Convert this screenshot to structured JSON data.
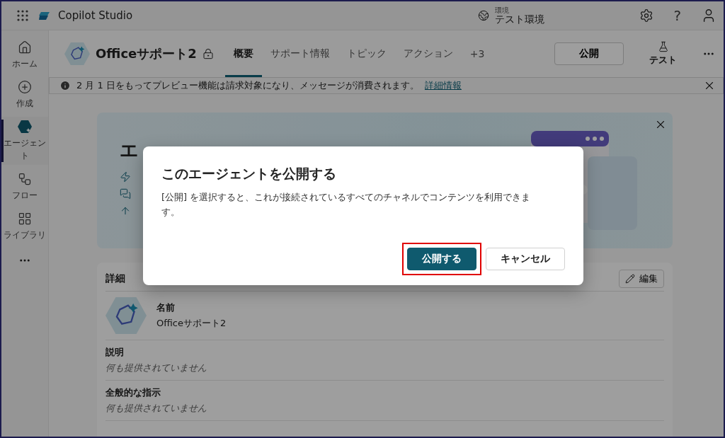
{
  "app": {
    "title": "Copilot Studio"
  },
  "environment": {
    "label": "環境",
    "name": "テスト環境"
  },
  "help": "?",
  "sidebar": {
    "items": [
      {
        "label": "ホーム",
        "selected": false
      },
      {
        "label": "作成",
        "selected": false
      },
      {
        "label": "エージェント",
        "selected": true
      },
      {
        "label": "フロー",
        "selected": false
      },
      {
        "label": "ライブラリ",
        "selected": false
      }
    ]
  },
  "agent": {
    "name": "Officeサポート2"
  },
  "tabs": [
    {
      "label": "概要",
      "selected": true
    },
    {
      "label": "サポート情報",
      "selected": false
    },
    {
      "label": "トピック",
      "selected": false
    },
    {
      "label": "アクション",
      "selected": false
    },
    {
      "label": "+3",
      "selected": false
    }
  ],
  "actions": {
    "publish": "公開",
    "test": "テスト"
  },
  "notice": {
    "text": "2 月 1 日をもってプレビュー機能は請求対象になり、メッセージが消費されます。",
    "link": "詳細情報"
  },
  "banner": {
    "heading": "エ"
  },
  "details": {
    "title": "詳細",
    "edit": "編集",
    "fields": [
      {
        "kind": "name",
        "label": "名前",
        "value": "Officeサポート2"
      },
      {
        "kind": "text",
        "label": "説明",
        "value": "何も提供されていません"
      },
      {
        "kind": "text",
        "label": "全般的な指示",
        "value": "何も提供されていません"
      }
    ]
  },
  "dialog": {
    "title": "このエージェントを公開する",
    "body": "[公開] を選択すると、これが接続されているすべてのチャネルでコンテンツを利用できます。",
    "buttons": [
      {
        "label": "公開する",
        "kind": "primary",
        "highlighted": true
      },
      {
        "label": "キャンセル",
        "kind": "secondary",
        "highlighted": false
      }
    ]
  }
}
